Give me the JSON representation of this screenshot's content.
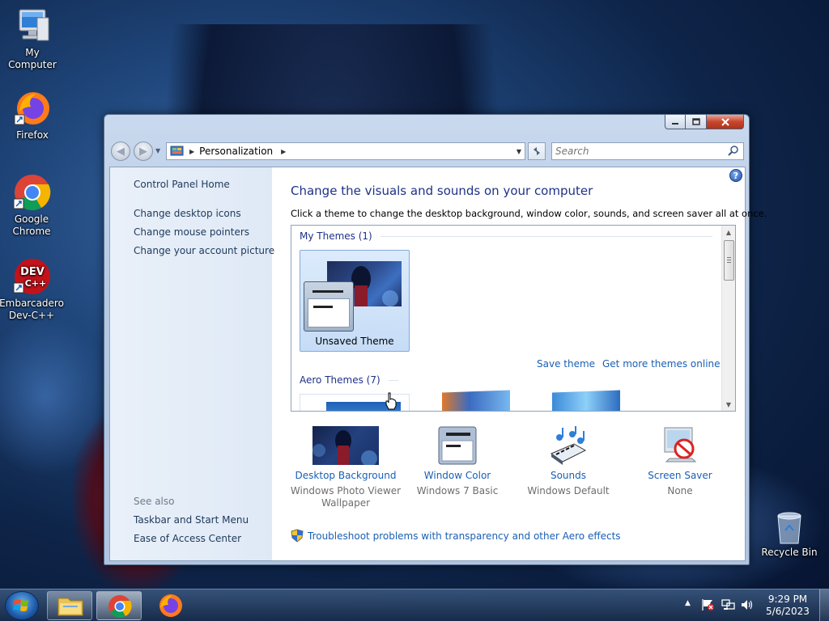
{
  "desktop": {
    "icons": [
      {
        "label": "My Computer"
      },
      {
        "label": "Firefox"
      },
      {
        "label": "Google Chrome"
      },
      {
        "label": "Embarcadero Dev-C++"
      },
      {
        "label": "Recycle Bin"
      }
    ],
    "devcpp_logo": "DEV C++"
  },
  "window": {
    "breadcrumb": "Personalization",
    "search_placeholder": "Search",
    "help_glyph": "?"
  },
  "left_pane": {
    "links": [
      "Control Panel Home",
      "Change desktop icons",
      "Change mouse pointers",
      "Change your account picture"
    ],
    "see_also_label": "See also",
    "see_also_links": [
      "Taskbar and Start Menu",
      "Ease of Access Center"
    ]
  },
  "main": {
    "title": "Change the visuals and sounds on your computer",
    "subtitle": "Click a theme to change the desktop background, window color, sounds, and screen saver all at once.",
    "my_themes_header": "My Themes (1)",
    "unsaved_theme": "Unsaved Theme",
    "save_theme": "Save theme",
    "get_more_themes": "Get more themes online",
    "aero_themes_header": "Aero Themes (7)",
    "bottom_items": [
      {
        "label": "Desktop Background",
        "value": "Windows Photo Viewer Wallpaper"
      },
      {
        "label": "Window Color",
        "value": "Windows 7 Basic"
      },
      {
        "label": "Sounds",
        "value": "Windows Default"
      },
      {
        "label": "Screen Saver",
        "value": "None"
      }
    ],
    "troubleshoot": "Troubleshoot problems with transparency and other Aero effects"
  },
  "taskbar": {
    "time": "9:29 PM",
    "date": "5/6/2023"
  },
  "colors": {
    "link": "#1a5fb4",
    "title": "#1e3287",
    "nav_link": "#1e395b"
  }
}
